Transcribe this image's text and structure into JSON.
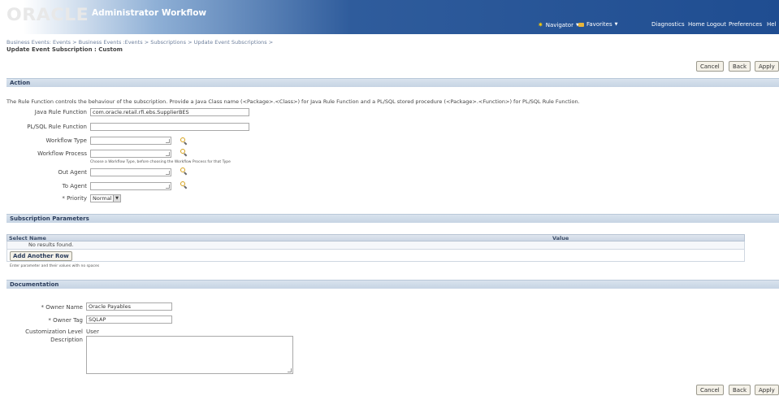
{
  "header": {
    "logo": "ORACLE",
    "app_title": "Administrator Workflow",
    "navigator": "Navigator",
    "favorites": "Favorites",
    "links": [
      "Diagnostics",
      "Home",
      "Logout",
      "Preferences",
      "Hel"
    ]
  },
  "breadcrumbs": [
    "Business Events: Events",
    "Business Events :Events",
    "Subscriptions",
    "Update Event Subscriptions"
  ],
  "breadcrumb_sep": ">",
  "page_title": "Update Event Subscription : Custom",
  "buttons": {
    "cancel": "Cancel",
    "back": "Back",
    "apply": "Apply"
  },
  "action_section": {
    "title": "Action",
    "instructions": "The Rule Function controls the behaviour of the subscription. Provide a Java Class name (<Package>.<Class>) for Java Rule Function and a PL/SQL stored procedure (<Package>.<Function>) for PL/SQL Rule Function.",
    "java_rule_function": {
      "label": "Java Rule Function",
      "value": "com.oracle.retail.rfi.ebs.SupplierBES"
    },
    "plsql_rule_function": {
      "label": "PL/SQL Rule Function",
      "value": ""
    },
    "workflow_type": {
      "label": "Workflow Type",
      "value": ""
    },
    "workflow_process": {
      "label": "Workflow Process",
      "value": "",
      "hint": "Choose a Workflow Type, before choosing the Workflow Process for that Type"
    },
    "out_agent": {
      "label": "Out Agent",
      "value": ""
    },
    "to_agent": {
      "label": "To Agent",
      "value": ""
    },
    "priority": {
      "label": "* Priority",
      "value": "Normal"
    }
  },
  "parameters_section": {
    "title": "Subscription Parameters",
    "columns": [
      "Select Name",
      "Value"
    ],
    "empty_text": "No results found.",
    "add_row": "Add Another Row",
    "hint": "Enter parameter and their values with no spaces"
  },
  "documentation_section": {
    "title": "Documentation",
    "owner_name": {
      "label": "* Owner Name",
      "value": "Oracle Payables"
    },
    "owner_tag": {
      "label": "* Owner Tag",
      "value": "SQLAP"
    },
    "customization_level": {
      "label": "Customization Level",
      "value": "User"
    },
    "description": {
      "label": "Description",
      "value": ""
    }
  },
  "colors": {
    "header_dark": "#1f4d91",
    "section_bar": "#c6d4e4",
    "button_bg": "#f4f1e8",
    "lov_icon": "#d6a21c"
  },
  "icons": [
    "search-icon",
    "star-icon",
    "folder-icon"
  ]
}
